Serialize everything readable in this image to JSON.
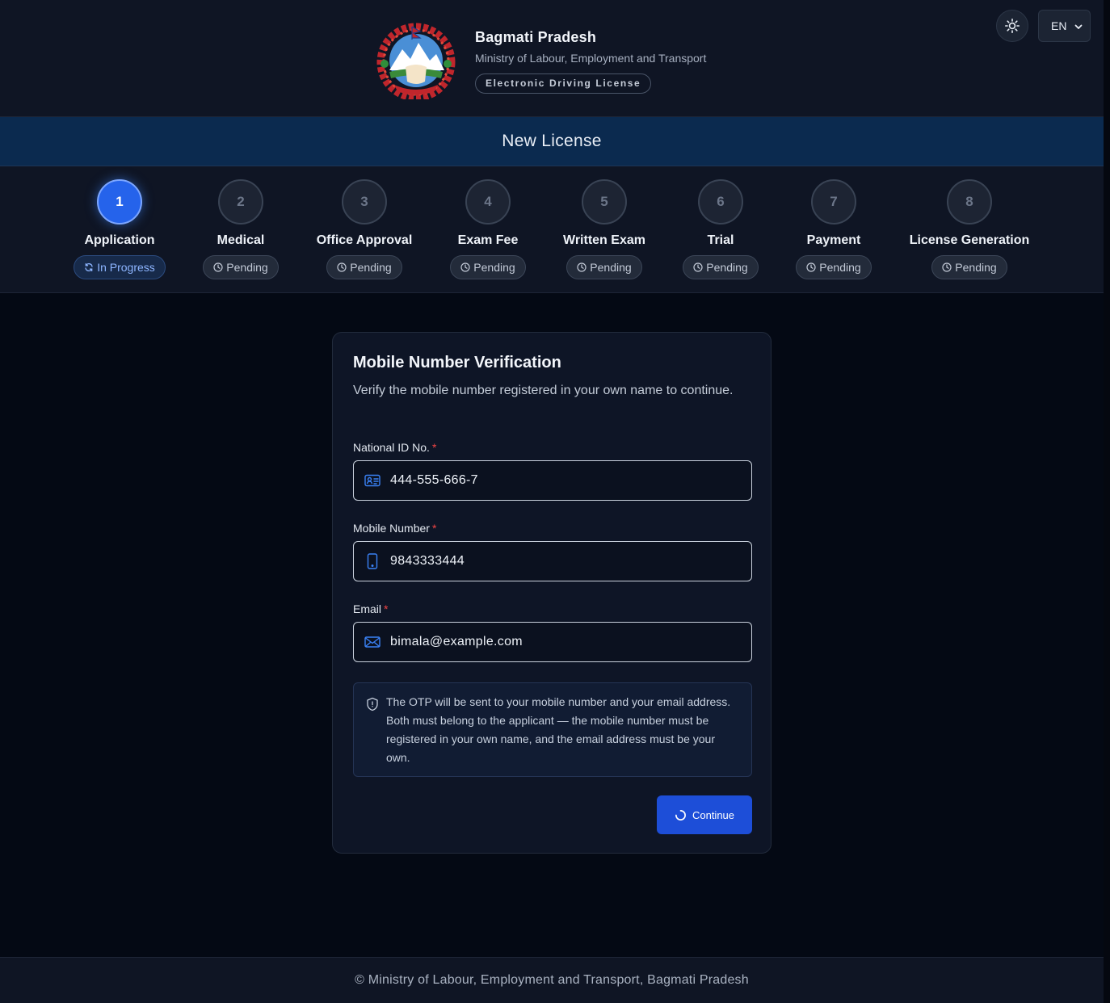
{
  "header": {
    "brand_title": "Bagmati Pradesh",
    "brand_subtitle": "Ministry of Labour, Employment and Transport",
    "brand_pill": "Electronic Driving License",
    "language": "EN"
  },
  "page": {
    "title": "New License"
  },
  "steps": [
    {
      "number": "1",
      "label": "Application",
      "status": "In Progress",
      "active": true
    },
    {
      "number": "2",
      "label": "Medical",
      "status": "Pending"
    },
    {
      "number": "3",
      "label": "Office Approval",
      "status": "Pending"
    },
    {
      "number": "4",
      "label": "Exam Fee",
      "status": "Pending"
    },
    {
      "number": "5",
      "label": "Written Exam",
      "status": "Pending"
    },
    {
      "number": "6",
      "label": "Trial",
      "status": "Pending"
    },
    {
      "number": "7",
      "label": "Payment",
      "status": "Pending"
    },
    {
      "number": "8",
      "label": "License Generation",
      "status": "Pending"
    }
  ],
  "form": {
    "title": "Mobile Number Verification",
    "description": "Verify the mobile number registered in your own name to continue.",
    "national_id": {
      "label": "National ID No.",
      "required": "*",
      "value": "444-555-666-7"
    },
    "mobile": {
      "label": "Mobile Number",
      "required": "*",
      "value": "9843333444"
    },
    "email": {
      "label": "Email",
      "required": "*",
      "value": "bimala@example.com"
    },
    "notice": "The OTP will be sent to your mobile number and your email address. Both must belong to the applicant — the mobile number must be registered in your own name, and the email address must be your own.",
    "continue_label": "Continue"
  },
  "footer": {
    "text": "© Ministry of Labour, Employment and Transport, Bagmati Pradesh"
  },
  "colors": {
    "accent": "#2563eb",
    "required": "#ef4444",
    "title_band": "#0b2a4f"
  }
}
